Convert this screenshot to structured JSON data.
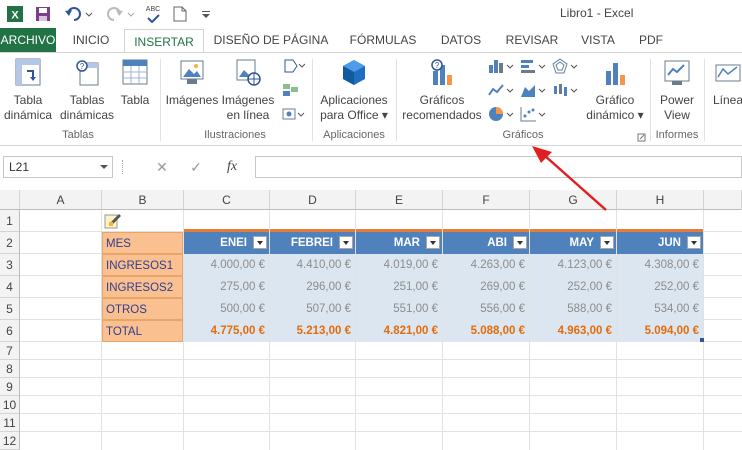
{
  "title_bar": {
    "title": "Libro1 - Excel",
    "abc_label": "ABC"
  },
  "tabs": [
    "ARCHIVO",
    "INICIO",
    "INSERTAR",
    "DISEÑO DE PÁGINA",
    "FÓRMULAS",
    "DATOS",
    "REVISAR",
    "VISTA",
    "PDF"
  ],
  "ribbon": {
    "buttons": {
      "tabla_dinamica": [
        "Tabla",
        "dinámica"
      ],
      "tablas_dinamicas": [
        "Tablas",
        "dinámicas"
      ],
      "tabla": [
        "Tabla"
      ],
      "imagenes": [
        "Imágenes"
      ],
      "imagenes_linea": [
        "Imágenes",
        "en línea"
      ],
      "aplicaciones_office": [
        "Aplicaciones",
        "para Office ▾"
      ],
      "graficos_recomendados": [
        "Gráficos",
        "recomendados"
      ],
      "grafico_dinamico": [
        "Gráfico",
        "dinámico ▾"
      ],
      "power_view": [
        "Power",
        "View"
      ],
      "linea": [
        "Línea"
      ]
    },
    "groups": {
      "tablas": "Tablas",
      "ilustraciones": "Ilustraciones",
      "aplicaciones": "Aplicaciones",
      "graficos": "Gráficos",
      "informes": "Informes"
    }
  },
  "formula_bar": {
    "name_box": "L21",
    "cancel": "✕",
    "enter": "✓",
    "fx": "fx",
    "value": ""
  },
  "sheet": {
    "columns": [
      "A",
      "B",
      "C",
      "D",
      "E",
      "F",
      "G",
      "H"
    ],
    "rows": [
      "1",
      "2",
      "3",
      "4",
      "5",
      "6",
      "7",
      "8",
      "9",
      "10",
      "11",
      "12"
    ],
    "labels": [
      "MES",
      "INGRESOS1",
      "INGRESOS2",
      "OTROS",
      "TOTAL"
    ],
    "headers": [
      "ENEI",
      "FEBREI",
      "MAR",
      "ABI",
      "MAY",
      "JUN"
    ],
    "data": [
      [
        "4.000,00 €",
        "4.410,00 €",
        "4.019,00 €",
        "4.263,00 €",
        "4.123,00 €",
        "4.308,00 €"
      ],
      [
        "275,00 €",
        "296,00 €",
        "251,00 €",
        "269,00 €",
        "252,00 €",
        "252,00 €"
      ],
      [
        "500,00 €",
        "507,00 €",
        "551,00 €",
        "556,00 €",
        "588,00 €",
        "534,00 €"
      ]
    ],
    "totals": [
      "4.775,00 €",
      "5.213,00 €",
      "4.821,00 €",
      "5.088,00 €",
      "4.963,00 €",
      "5.094,00 €"
    ]
  },
  "colors": {
    "excel_green": "#217346",
    "header_blue": "#4f81bd",
    "label_orange": "#fac090",
    "data_fill": "#dce6f1",
    "total_text": "#e46c0a",
    "arrow_red": "#e02020"
  }
}
